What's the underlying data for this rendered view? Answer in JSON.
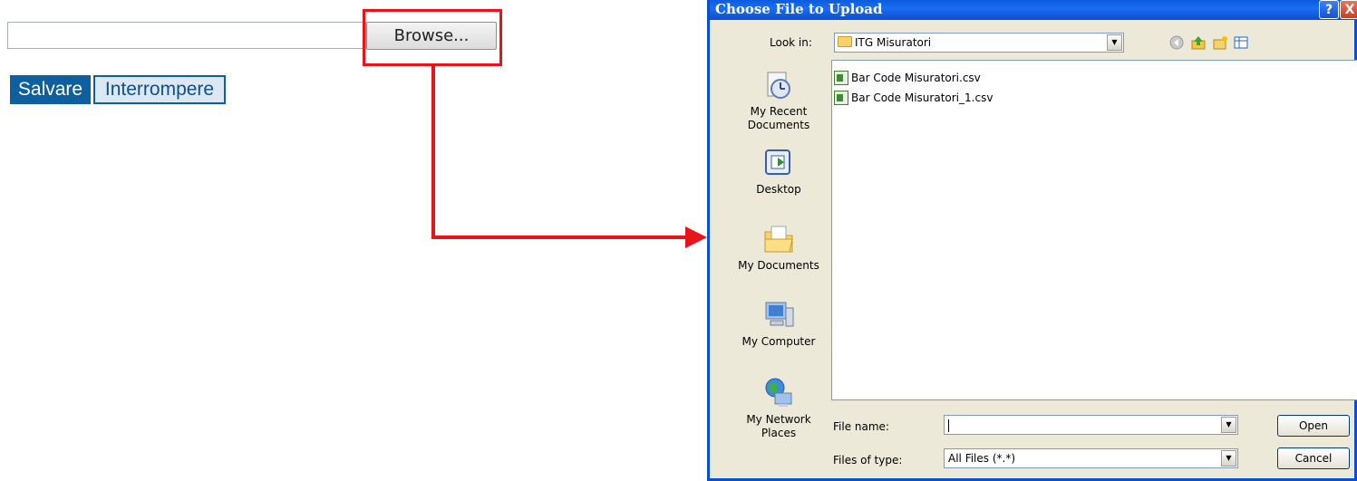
{
  "web_form": {
    "file_input_value": "",
    "browse_label": "Browse...",
    "save_label": "Salvare",
    "abort_label": "Interrompere"
  },
  "annotation": {
    "highlight_color": "#e8141a"
  },
  "dialog": {
    "title": "Choose File to Upload",
    "help_glyph": "?",
    "close_glyph": "X",
    "look_in_label": "Look in:",
    "look_in_value": "ITG Misuratori",
    "toolbar_icons": [
      "back-icon",
      "up-folder-icon",
      "new-folder-icon",
      "view-menu-icon"
    ],
    "places": [
      {
        "label": "My Recent Documents",
        "icon": "recent-documents-icon"
      },
      {
        "label": "Desktop",
        "icon": "desktop-icon"
      },
      {
        "label": "My Documents",
        "icon": "my-documents-icon"
      },
      {
        "label": "My Computer",
        "icon": "my-computer-icon"
      },
      {
        "label": "My Network Places",
        "icon": "network-places-icon"
      }
    ],
    "files": [
      {
        "name": "Bar Code Misuratori.csv"
      },
      {
        "name": "Bar Code Misuratori_1.csv"
      }
    ],
    "file_name_label": "File name:",
    "file_name_value": "",
    "files_of_type_label": "Files of type:",
    "files_of_type_value": "All Files (*.*)",
    "open_label": "Open",
    "cancel_label": "Cancel"
  }
}
